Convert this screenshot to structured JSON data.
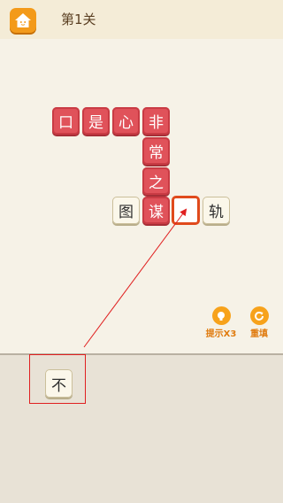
{
  "header": {
    "title": "第1关",
    "home_icon": "house-icon"
  },
  "board": {
    "tiles_row": [
      "口",
      "是",
      "心",
      "非"
    ],
    "tiles_col": [
      "常",
      "之"
    ],
    "row2": {
      "left": "图",
      "mid": "谋",
      "right": "轨"
    }
  },
  "tools": {
    "hint": "提示",
    "hint_count": "X3",
    "reset": "重填"
  },
  "tray": {
    "candidate": "不"
  },
  "colors": {
    "accent": "#f39a1a",
    "red_tile": "#e0525a",
    "highlight": "#e04a1c"
  }
}
